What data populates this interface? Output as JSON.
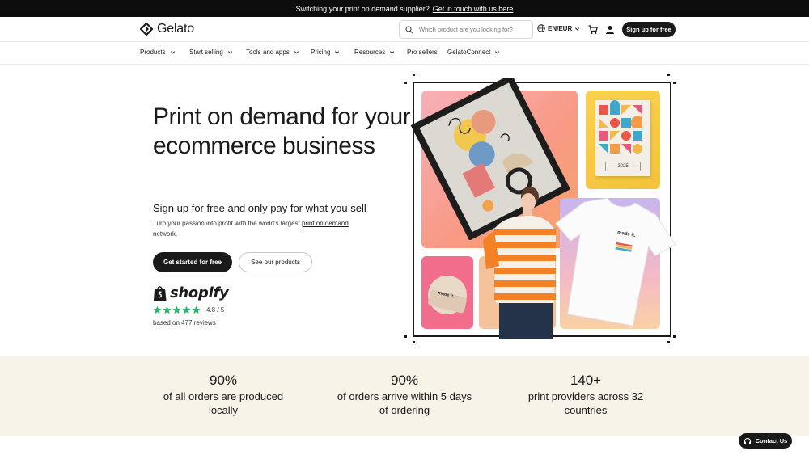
{
  "announcement": {
    "text": "Switching your print on demand supplier?",
    "link": "Get in touch with us here"
  },
  "header": {
    "logo_text": "Gelato",
    "search_placeholder": "Which product are you looking for?",
    "locale": "EN/EUR",
    "signup_label": "Sign up for free"
  },
  "nav": {
    "items": [
      {
        "label": "Products",
        "dropdown": true
      },
      {
        "label": "Start selling",
        "dropdown": true
      },
      {
        "label": "Tools and apps",
        "dropdown": true
      },
      {
        "label": "Pricing",
        "dropdown": true
      },
      {
        "label": "Resources",
        "dropdown": true
      },
      {
        "label": "Pro sellers",
        "dropdown": false
      },
      {
        "label": "GelatoConnect",
        "dropdown": true
      }
    ]
  },
  "hero": {
    "title": "Print on demand for your ecommerce business",
    "subtitle": "Sign up for free and only pay for what you sell",
    "desc_prefix": "Turn your passion into profit with the world's largest ",
    "desc_link": "print on demand",
    "desc_suffix": " network.",
    "primary_cta": "Get started for free",
    "secondary_cta": "See our products",
    "shopify_label": "shopify",
    "rating": "4.8 / 5",
    "rating_value": 4.8,
    "rating_max": 5,
    "reviews": "based on 477 reviews",
    "calendar_year": "2025",
    "tshirt_print": "made it.",
    "beanie_print": "made it."
  },
  "stats": [
    {
      "value": "90%",
      "label": "of all orders are produced locally"
    },
    {
      "value": "90%",
      "label": "of orders arrive within 5 days of ordering"
    },
    {
      "value": "140+",
      "label": "print providers across 32 countries"
    }
  ],
  "contact_label": "Contact Us",
  "colors": {
    "dark": "#1a1a1a",
    "star_green": "#2bb673",
    "stats_bg": "#f7f3e8"
  }
}
